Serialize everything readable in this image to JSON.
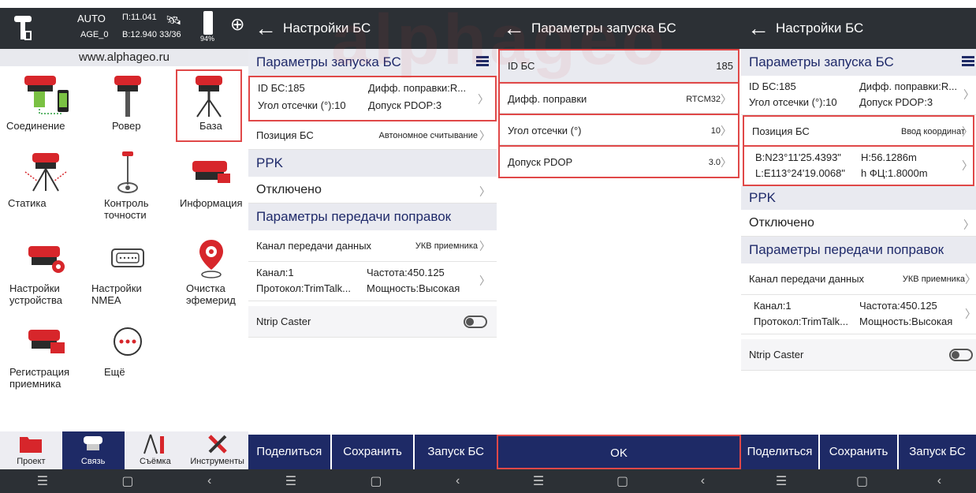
{
  "watermark": "alphageo",
  "screen1": {
    "status": {
      "mode": "AUTO",
      "age": "AGE_0",
      "p": "П:11.041",
      "b": "В:12.940 33/36",
      "battery": "94%"
    },
    "url": "www.alphageo.ru",
    "items": [
      {
        "label": "Соединение"
      },
      {
        "label": "Ровер"
      },
      {
        "label": "База"
      },
      {
        "label": "Статика"
      },
      {
        "label": "Контроль точности"
      },
      {
        "label": "Информация"
      },
      {
        "label": "Настройки устройства"
      },
      {
        "label": "Настройки NMEA"
      },
      {
        "label": "Очистка эфемерид"
      },
      {
        "label": "Регистрация приемника"
      },
      {
        "label": "Ещё"
      }
    ],
    "tabs": [
      {
        "label": "Проект"
      },
      {
        "label": "Связь"
      },
      {
        "label": "Съёмка"
      },
      {
        "label": "Инструменты"
      }
    ]
  },
  "screen2": {
    "title": "Настройки БС",
    "section1": "Параметры запуска БС",
    "id": "ID БС:185",
    "diff": "Дифф. поправки:R...",
    "angle": "Угол отсечки (°):10",
    "pdop": "Допуск PDOP:3",
    "pos_label": "Позиция БС",
    "pos_value": "Автономное считывание",
    "ppk": "PPK",
    "ppk_value": "Отключено",
    "section2": "Параметры передачи поправок",
    "channel_label": "Канал передачи данных",
    "channel_value": "УКВ приемника",
    "kanal": "Канал:1",
    "freq": "Частота:450.125",
    "proto": "Протокол:TrimTalk...",
    "power": "Мощность:Высокая",
    "ntrip": "Ntrip Caster",
    "buttons": {
      "share": "Поделиться",
      "save": "Сохранить",
      "start": "Запуск БС"
    }
  },
  "screen3": {
    "title": "Параметры запуска БС",
    "rows": [
      {
        "label": "ID БС",
        "value": "185"
      },
      {
        "label": "Дифф. поправки",
        "value": "RTCM32"
      },
      {
        "label": "Угол отсечки (°)",
        "value": "10"
      },
      {
        "label": "Допуск PDOP",
        "value": "3.0"
      }
    ],
    "ok": "OK"
  },
  "screen4": {
    "title": "Настройки БС",
    "section1": "Параметры запуска БС",
    "id": "ID БС:185",
    "diff": "Дифф. поправки:R...",
    "angle": "Угол отсечки (°):10",
    "pdop": "Допуск PDOP:3",
    "pos_label": "Позиция БС",
    "pos_value": "Ввод координат",
    "lat": "B:N23°11'25.4393\"",
    "h": "H:56.1286m",
    "lon": "L:E113°24'19.0068\"",
    "hfc": "h ФЦ:1.8000m",
    "ppk": "PPK",
    "ppk_value": "Отключено",
    "section2": "Параметры передачи поправок",
    "channel_label": "Канал передачи данных",
    "channel_value": "УКВ приемника",
    "kanal": "Канал:1",
    "freq": "Частота:450.125",
    "proto": "Протокол:TrimTalk...",
    "power": "Мощность:Высокая",
    "ntrip": "Ntrip Caster",
    "buttons": {
      "share": "Поделиться",
      "save": "Сохранить",
      "start": "Запуск БС"
    }
  },
  "colors": {
    "dark": "#2c3035",
    "navy": "#1e2a66",
    "highlight": "#e04848",
    "section_bg": "#e9eaf0"
  }
}
